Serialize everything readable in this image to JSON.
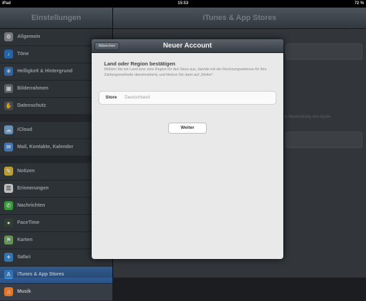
{
  "status_bar": {
    "left": "iPad",
    "time": "15:53",
    "battery": "72 %"
  },
  "sidebar": {
    "title": "Einstellungen",
    "items": [
      {
        "label": "Allgemein",
        "icon": "gear-icon",
        "color": "#8e9399",
        "glyph": "⚙"
      },
      {
        "label": "Töne",
        "icon": "speaker-icon",
        "color": "#2e79c9",
        "glyph": "♪"
      },
      {
        "label": "Helligkeit & Hintergrund",
        "icon": "brightness-icon",
        "color": "#3e78c2",
        "glyph": "☀"
      },
      {
        "label": "Bilderrahmen",
        "icon": "picture-frame-icon",
        "color": "#6c737a",
        "glyph": "▣"
      },
      {
        "label": "Datenschutz",
        "icon": "privacy-hand-icon",
        "color": "#555b61",
        "glyph": "✋"
      },
      {
        "label": "iCloud",
        "icon": "cloud-icon",
        "color": "#7fb0e0",
        "glyph": "☁"
      },
      {
        "label": "Mail, Kontakte, Kalender",
        "icon": "mail-icon",
        "color": "#4f8fd8",
        "glyph": "✉"
      },
      {
        "label": "Notizen",
        "icon": "notes-icon",
        "color": "#e0c040",
        "glyph": "✎"
      },
      {
        "label": "Erinnerungen",
        "icon": "reminders-icon",
        "color": "#e8e8e8",
        "glyph": "☰"
      },
      {
        "label": "Nachrichten",
        "icon": "messages-icon",
        "color": "#45b848",
        "glyph": "✆"
      },
      {
        "label": "FaceTime",
        "icon": "facetime-icon",
        "color": "#3c4b3c",
        "glyph": "●"
      },
      {
        "label": "Karten",
        "icon": "maps-icon",
        "color": "#7bb36b",
        "glyph": "⚑"
      },
      {
        "label": "Safari",
        "icon": "compass-icon",
        "color": "#3c8ed8",
        "glyph": "✦"
      },
      {
        "label": "iTunes & App Stores",
        "icon": "app-store-icon",
        "color": "#3b8de0",
        "glyph": "A"
      },
      {
        "label": "Musik",
        "icon": "music-icon",
        "color": "#e0762e",
        "glyph": "♫"
      }
    ]
  },
  "detail": {
    "title": "iTunes & App Stores",
    "background_hint": "e Verwendung von Apple-"
  },
  "modal": {
    "cancel_label": "Abbrechen",
    "title": "Neuer Account",
    "section_heading": "Land oder Region bestätigen",
    "section_text": "Wählen Sie ein Land bzw. eine Region für den Store aus, das/die mit der Rechnungsadresse für Ihre Zahlungsmethode übereinstimmt, und klicken Sie dann auf „Weiter\".",
    "store_label": "Store",
    "store_value": "Deutschland",
    "next_label": "Weiter"
  },
  "colors": {
    "selected_row": "#2f5f99",
    "modal_bg": "#e9e9e9",
    "nav_bar": "#3d454d"
  }
}
